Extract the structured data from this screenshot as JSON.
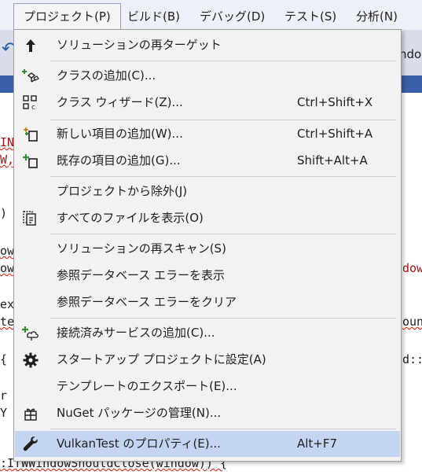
{
  "menubar": {
    "items": [
      {
        "label": "プロジェクト(P)"
      },
      {
        "label": "ビルド(B)"
      },
      {
        "label": "デバッグ(D)"
      },
      {
        "label": "テスト(S)"
      },
      {
        "label": "分析(N)"
      }
    ]
  },
  "background": {
    "toolbar_text": "ndo",
    "code": [
      {
        "text": "INI"
      },
      {
        "text": "W,"
      },
      {
        "text": ")"
      },
      {
        "text": "owh"
      },
      {
        "text": "ow"
      },
      {
        "text": "ex"
      },
      {
        "text": "te"
      },
      {
        "text": "{"
      },
      {
        "text": "r"
      },
      {
        "text": "Y"
      },
      {
        "text": ":IfWWindowShouldClose(window)) {"
      },
      {
        "text": "dow\""
      },
      {
        "text": "ount"
      },
      {
        "text": "d::"
      }
    ]
  },
  "menu": {
    "items": [
      {
        "icon": "arrow-up-icon",
        "label": "ソリューションの再ターゲット",
        "shortcut": ""
      },
      {
        "icon": "add-class-icon",
        "label": "クラスの追加(C)...",
        "shortcut": ""
      },
      {
        "icon": "class-wizard-icon",
        "label": "クラス ウィザード(Z)...",
        "shortcut": "Ctrl+Shift+X"
      },
      {
        "icon": "new-item-icon",
        "label": "新しい項目の追加(W)...",
        "shortcut": "Ctrl+Shift+A"
      },
      {
        "icon": "existing-item-icon",
        "label": "既存の項目の追加(G)...",
        "shortcut": "Shift+Alt+A"
      },
      {
        "icon": "",
        "label": "プロジェクトから除外(J)",
        "shortcut": ""
      },
      {
        "icon": "show-all-files-icon",
        "label": "すべてのファイルを表示(O)",
        "shortcut": ""
      },
      {
        "icon": "",
        "label": "ソリューションの再スキャン(S)",
        "shortcut": ""
      },
      {
        "icon": "",
        "label": "参照データベース エラーを表示",
        "shortcut": ""
      },
      {
        "icon": "",
        "label": "参照データベース エラーをクリア",
        "shortcut": ""
      },
      {
        "icon": "connected-service-icon",
        "label": "接続済みサービスの追加(C)...",
        "shortcut": ""
      },
      {
        "icon": "gear-icon",
        "label": "スタートアップ プロジェクトに設定(A)",
        "shortcut": ""
      },
      {
        "icon": "",
        "label": "テンプレートのエクスポート(E)...",
        "shortcut": ""
      },
      {
        "icon": "nuget-icon",
        "label": "NuGet パッケージの管理(N)...",
        "shortcut": ""
      },
      {
        "icon": "wrench-icon",
        "label": "VulkanTest のプロパティ(E)...",
        "shortcut": "Alt+F7"
      }
    ]
  },
  "colors": {
    "menu_bg": "#f2f2f2",
    "highlight": "#c4d5f2",
    "icon_green": "#388a34",
    "icon_orange": "#c27d0e"
  }
}
